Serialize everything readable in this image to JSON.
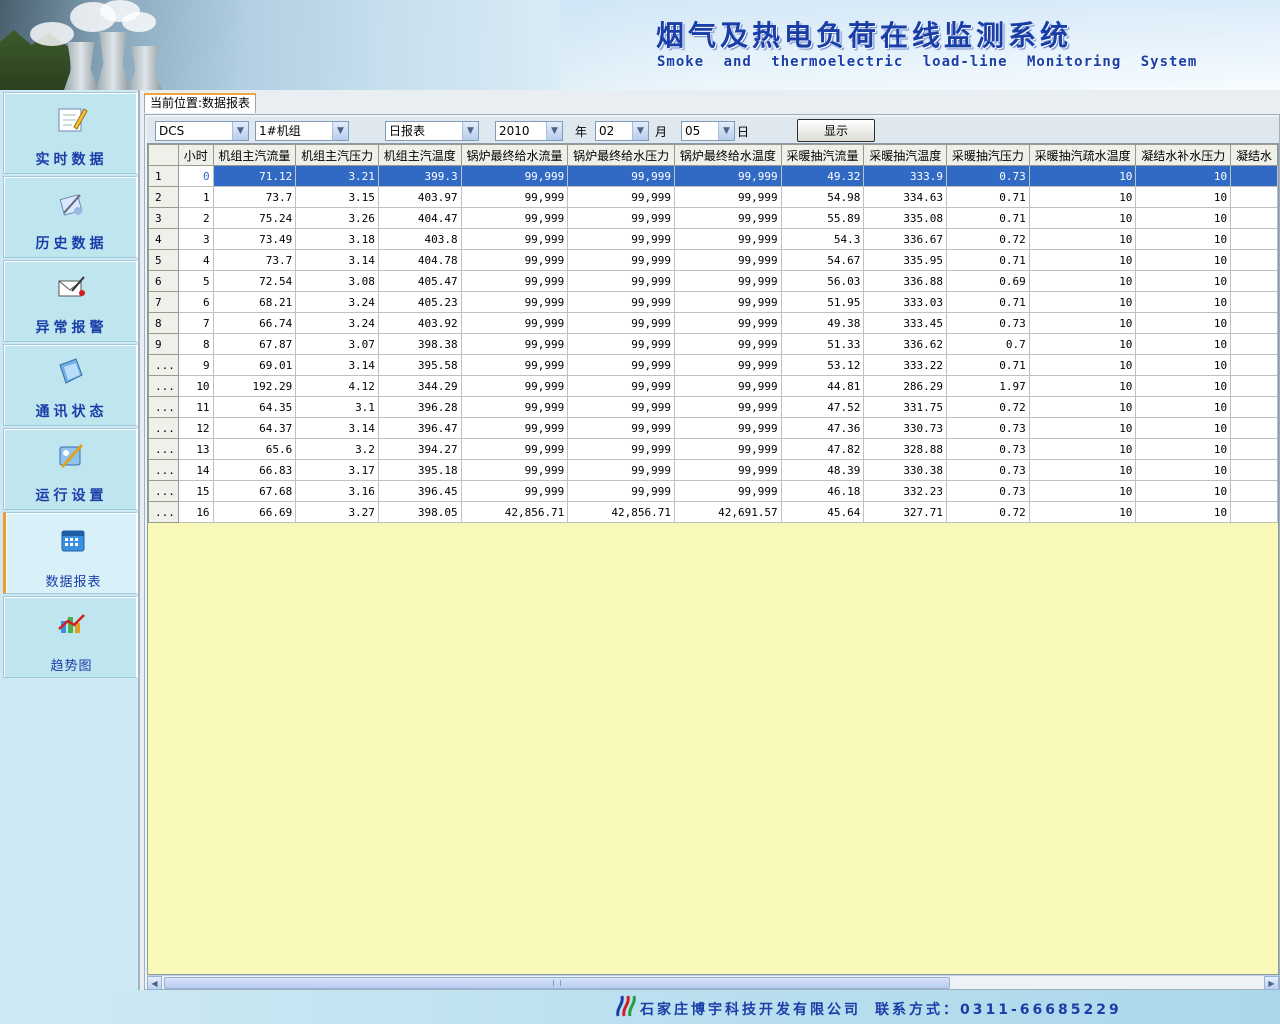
{
  "banner": {
    "title": "烟气及热电负荷在线监测系统",
    "subtitle": "Smoke and thermoelectric load-line Monitoring System"
  },
  "sidebar": {
    "items": [
      {
        "label": "实时数据",
        "icon": "notepad-pencil-icon"
      },
      {
        "label": "历史数据",
        "icon": "history-tools-icon"
      },
      {
        "label": "异常报警",
        "icon": "alarm-envelope-icon"
      },
      {
        "label": "通讯状态",
        "icon": "communication-icon"
      },
      {
        "label": "运行设置",
        "icon": "settings-tools-icon"
      },
      {
        "label": "数据报表",
        "icon": "calendar-icon",
        "active": true
      },
      {
        "label": "趋势图",
        "icon": "trend-chart-icon"
      }
    ]
  },
  "location": {
    "label": "当前位置:数据报表"
  },
  "toolbar": {
    "source": "DCS",
    "unit": "1#机组",
    "report_type": "日报表",
    "year": "2010",
    "year_label": "年",
    "month": "02",
    "month_label": "月",
    "day": "05",
    "day_label": "日",
    "show_label": "显示"
  },
  "table": {
    "columns": [
      "小时",
      "机组主汽流量",
      "机组主汽压力",
      "机组主汽温度",
      "锅炉最终给水流量",
      "锅炉最终给水压力",
      "锅炉最终给水温度",
      "采暖抽汽流量",
      "采暖抽汽温度",
      "采暖抽汽压力",
      "采暖抽汽疏水温度",
      "凝结水补水压力",
      "凝结水"
    ],
    "row_headers": [
      "1",
      "2",
      "3",
      "4",
      "5",
      "6",
      "7",
      "8",
      "9",
      "...",
      "...",
      "...",
      "...",
      "...",
      "...",
      "...",
      "..."
    ],
    "selected_row": 0,
    "rows": [
      [
        "0",
        "71.12",
        "3.21",
        "399.3",
        "99,999",
        "99,999",
        "99,999",
        "49.32",
        "333.9",
        "0.73",
        "10",
        "10",
        ""
      ],
      [
        "1",
        "73.7",
        "3.15",
        "403.97",
        "99,999",
        "99,999",
        "99,999",
        "54.98",
        "334.63",
        "0.71",
        "10",
        "10",
        ""
      ],
      [
        "2",
        "75.24",
        "3.26",
        "404.47",
        "99,999",
        "99,999",
        "99,999",
        "55.89",
        "335.08",
        "0.71",
        "10",
        "10",
        ""
      ],
      [
        "3",
        "73.49",
        "3.18",
        "403.8",
        "99,999",
        "99,999",
        "99,999",
        "54.3",
        "336.67",
        "0.72",
        "10",
        "10",
        ""
      ],
      [
        "4",
        "73.7",
        "3.14",
        "404.78",
        "99,999",
        "99,999",
        "99,999",
        "54.67",
        "335.95",
        "0.71",
        "10",
        "10",
        ""
      ],
      [
        "5",
        "72.54",
        "3.08",
        "405.47",
        "99,999",
        "99,999",
        "99,999",
        "56.03",
        "336.88",
        "0.69",
        "10",
        "10",
        ""
      ],
      [
        "6",
        "68.21",
        "3.24",
        "405.23",
        "99,999",
        "99,999",
        "99,999",
        "51.95",
        "333.03",
        "0.71",
        "10",
        "10",
        ""
      ],
      [
        "7",
        "66.74",
        "3.24",
        "403.92",
        "99,999",
        "99,999",
        "99,999",
        "49.38",
        "333.45",
        "0.73",
        "10",
        "10",
        ""
      ],
      [
        "8",
        "67.87",
        "3.07",
        "398.38",
        "99,999",
        "99,999",
        "99,999",
        "51.33",
        "336.62",
        "0.7",
        "10",
        "10",
        ""
      ],
      [
        "9",
        "69.01",
        "3.14",
        "395.58",
        "99,999",
        "99,999",
        "99,999",
        "53.12",
        "333.22",
        "0.71",
        "10",
        "10",
        ""
      ],
      [
        "10",
        "192.29",
        "4.12",
        "344.29",
        "99,999",
        "99,999",
        "99,999",
        "44.81",
        "286.29",
        "1.97",
        "10",
        "10",
        ""
      ],
      [
        "11",
        "64.35",
        "3.1",
        "396.28",
        "99,999",
        "99,999",
        "99,999",
        "47.52",
        "331.75",
        "0.72",
        "10",
        "10",
        ""
      ],
      [
        "12",
        "64.37",
        "3.14",
        "396.47",
        "99,999",
        "99,999",
        "99,999",
        "47.36",
        "330.73",
        "0.73",
        "10",
        "10",
        ""
      ],
      [
        "13",
        "65.6",
        "3.2",
        "394.27",
        "99,999",
        "99,999",
        "99,999",
        "47.82",
        "328.88",
        "0.73",
        "10",
        "10",
        ""
      ],
      [
        "14",
        "66.83",
        "3.17",
        "395.18",
        "99,999",
        "99,999",
        "99,999",
        "48.39",
        "330.38",
        "0.73",
        "10",
        "10",
        ""
      ],
      [
        "15",
        "67.68",
        "3.16",
        "396.45",
        "99,999",
        "99,999",
        "99,999",
        "46.18",
        "332.23",
        "0.73",
        "10",
        "10",
        ""
      ],
      [
        "16",
        "66.69",
        "3.27",
        "398.05",
        "42,856.71",
        "42,856.71",
        "42,691.57",
        "45.64",
        "327.71",
        "0.72",
        "10",
        "10",
        ""
      ]
    ]
  },
  "footer": {
    "company": "石家庄博宇科技开发有限公司",
    "contact": "联系方式：0311-66685229"
  },
  "colors": {
    "title_blue": "#1a3ea8",
    "selection_blue": "#316ac5",
    "grid_empty": "#f8f8b8",
    "active_accent": "#f19b2c"
  }
}
